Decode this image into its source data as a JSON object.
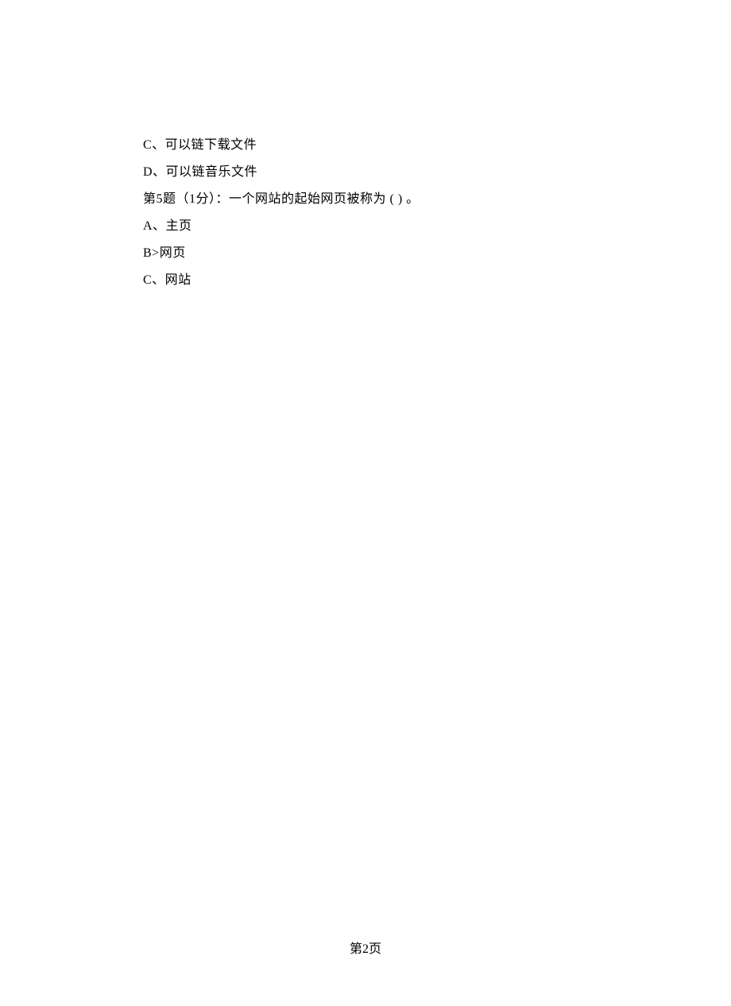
{
  "lines": {
    "optionC": "C、可以链下载文件",
    "optionD": "D、可以链音乐文件",
    "question5": "第5题（1分）：一个网站的起始网页被称为 ( ) 。",
    "optionA": "A、主页",
    "optionB": "B>网页",
    "optionC2": "C、网站"
  },
  "footer": "第2页"
}
